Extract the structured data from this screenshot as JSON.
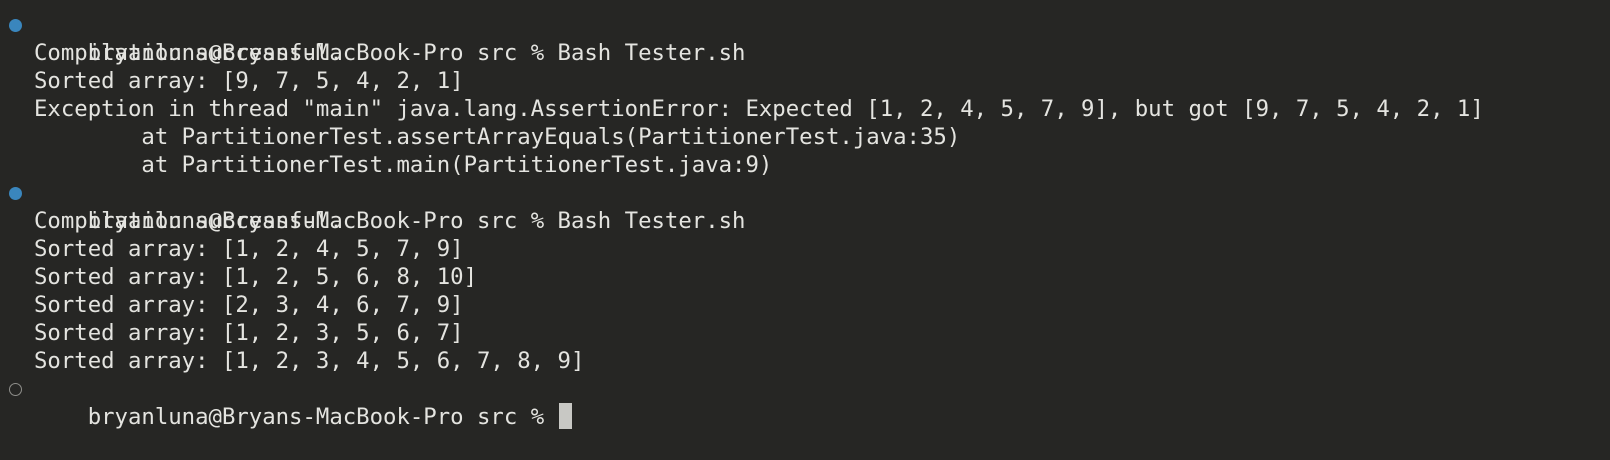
{
  "terminal": {
    "colors": {
      "background": "#262624",
      "text": "#e4e4e0",
      "success_marker": "#3a86bd",
      "pending_marker": "#8e8e8a",
      "cursor": "#c8c8c4"
    },
    "prompt_1": "bryanluna@Bryans-MacBook-Pro src % Bash Tester.sh",
    "output_1": [
      "Compilation successful.",
      "Sorted array: [9, 7, 5, 4, 2, 1]",
      "Exception in thread \"main\" java.lang.AssertionError: Expected [1, 2, 4, 5, 7, 9], but got [9, 7, 5, 4, 2, 1]",
      "        at PartitionerTest.assertArrayEquals(PartitionerTest.java:35)",
      "        at PartitionerTest.main(PartitionerTest.java:9)"
    ],
    "prompt_2": "bryanluna@Bryans-MacBook-Pro src % Bash Tester.sh",
    "output_2": [
      "Compilation successful.",
      "Sorted array: [1, 2, 4, 5, 7, 9]",
      "Sorted array: [1, 2, 5, 6, 8, 10]",
      "Sorted array: [2, 3, 4, 6, 7, 9]",
      "Sorted array: [1, 2, 3, 5, 6, 7]",
      "Sorted array: [1, 2, 3, 4, 5, 6, 7, 8, 9]"
    ],
    "prompt_3": "bryanluna@Bryans-MacBook-Pro src % "
  }
}
